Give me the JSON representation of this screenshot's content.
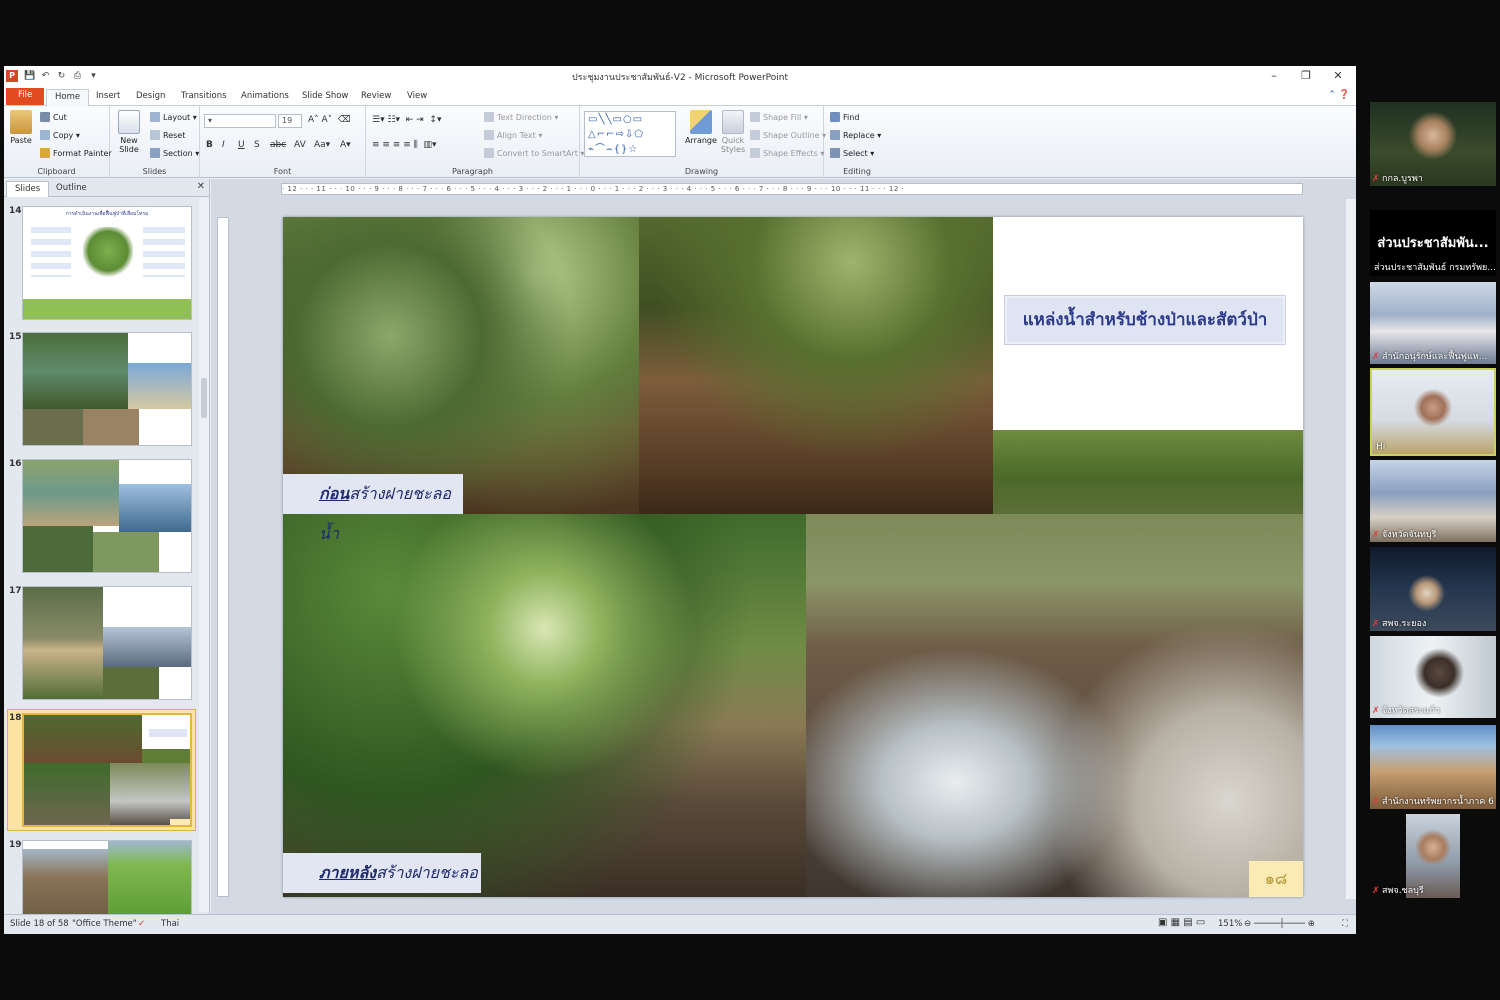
{
  "window": {
    "title": "ประชุมงานประชาสัมพันธ์-V2 - Microsoft PowerPoint",
    "minimize": "–",
    "restore": "❐",
    "close": "✕",
    "qat": [
      "P",
      "💾",
      "↶",
      "↻",
      "⎙",
      "▾"
    ]
  },
  "ribbon_tabs": [
    "File",
    "Home",
    "Insert",
    "Design",
    "Transitions",
    "Animations",
    "Slide Show",
    "Review",
    "View"
  ],
  "active_tab": "Home",
  "ribbon": {
    "clipboard": {
      "paste": "Paste",
      "cut": "Cut",
      "copy": "Copy",
      "format_painter": "Format Painter",
      "label": "Clipboard"
    },
    "slides": {
      "new_slide": "New Slide",
      "layout": "Layout",
      "reset": "Reset",
      "section": "Section",
      "label": "Slides"
    },
    "font": {
      "font_size": "19",
      "label": "Font"
    },
    "paragraph": {
      "text_direction": "Text Direction",
      "align_text": "Align Text",
      "convert_smartart": "Convert to SmartArt",
      "label": "Paragraph"
    },
    "drawing": {
      "arrange": "Arrange",
      "quick_styles": "Quick Styles",
      "shape_fill": "Shape Fill",
      "shape_outline": "Shape Outline",
      "shape_effects": "Shape Effects",
      "label": "Drawing"
    },
    "editing": {
      "find": "Find",
      "replace": "Replace",
      "select": "Select",
      "label": "Editing"
    }
  },
  "pane_tabs": [
    "Slides",
    "Outline"
  ],
  "thumbnails": [
    {
      "num": "14",
      "title": "การดำเนินงานเพื่อฟื้นฟูป่าที่เสื่อมโทรม"
    },
    {
      "num": "15"
    },
    {
      "num": "16"
    },
    {
      "num": "17"
    },
    {
      "num": "18",
      "selected": true
    },
    {
      "num": "19"
    }
  ],
  "ruler_text": "· 12 · · · 11 · · · 10 · · · 9 · · · 8 · · · 7 · · · 6 · · · 5 · · · 4 · · · 3 · · · 2 · · · 1 · · · 0 · · · 1 · · · 2 · · · 3 · · · 4 · · · 5 · · · 6 · · · 7 · · · 8 · · · 9 · · · 10 · · · 11 · · · 12 ·",
  "slide": {
    "title": "แหล่งน้ำสำหรับช้างป่าและสัตว์ป่า",
    "caption_before_emph": "ก่อน",
    "caption_before_rest": "สร้างฝายชะลอน้ำ",
    "caption_after_emph": "ภายหลัง",
    "caption_after_rest": "สร้างฝายชะลอน้ำ",
    "page_number": "๑๘"
  },
  "status": {
    "slide_info": "Slide 18 of 58",
    "theme": "\"Office Theme\"",
    "language": "Thai",
    "zoom": "151%"
  },
  "participants": [
    {
      "name": "กกล.บูรพา"
    },
    {
      "heading": "ส่วนประชาสัมพัน...",
      "name": "ส่วนประชาสัมพันธ์ กรมทรัพย..."
    },
    {
      "name": "สำนักอนุรักษ์และฟื้นฟูแห..."
    },
    {
      "name": "Hi"
    },
    {
      "name": "จังหวัดจันทบุรี"
    },
    {
      "name": "สพจ.ระยอง"
    },
    {
      "name": "จังหวัดสระแก้ว"
    },
    {
      "name": "สำนักงานทรัพยากรน้ำภาค 6"
    },
    {
      "name": "สพจ.ชลบุรี"
    }
  ],
  "colors": {
    "file_tab": "#e14b1e",
    "slide_title": "#2d3b8a",
    "selected_thumb": "#e8b73a",
    "mic_muted": "#e23b3b"
  }
}
